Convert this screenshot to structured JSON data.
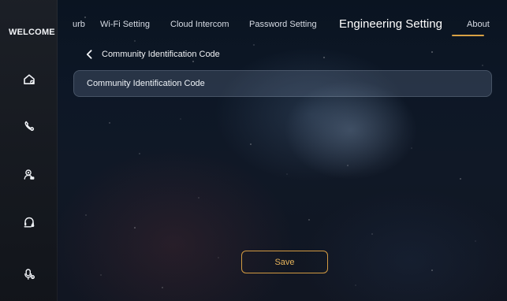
{
  "sidebar": {
    "welcome": "WELCOME",
    "items": [
      {
        "icon": "home-icon"
      },
      {
        "icon": "call-icon"
      },
      {
        "icon": "camera-user-icon"
      },
      {
        "icon": "headset-icon"
      },
      {
        "icon": "microphone-icon"
      }
    ]
  },
  "tabs": [
    {
      "label": "urb"
    },
    {
      "label": "Wi-Fi Setting"
    },
    {
      "label": "Cloud Intercom"
    },
    {
      "label": "Password Setting"
    },
    {
      "label": "Engineering Setting",
      "active": true
    },
    {
      "label": "About"
    }
  ],
  "page": {
    "title": "Community Identification Code"
  },
  "form": {
    "community_code_placeholder": "Community Identification Code"
  },
  "actions": {
    "save_label": "Save"
  },
  "colors": {
    "accent": "#d8a144",
    "sidebar_bg": "#1b1f25",
    "field_bg": "#9fb5d2"
  }
}
